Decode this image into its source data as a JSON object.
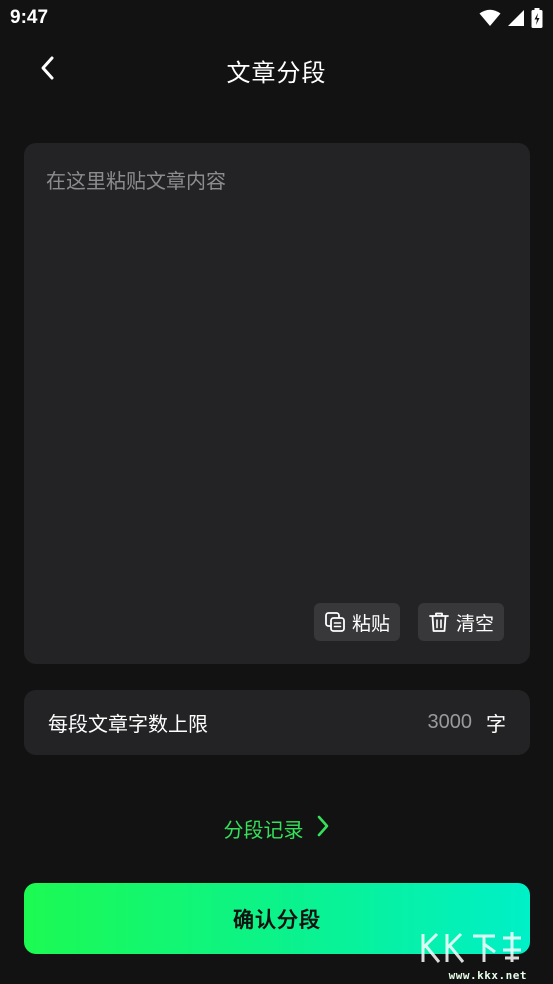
{
  "status_bar": {
    "time": "9:47",
    "icons": [
      "wifi-icon",
      "signal-icon",
      "battery-icon"
    ]
  },
  "header": {
    "title": "文章分段",
    "back_icon": "chevron-left-icon"
  },
  "article_input": {
    "placeholder": "在这里粘贴文章内容",
    "value": ""
  },
  "actions": {
    "paste_label": "粘贴",
    "paste_icon": "paste-icon",
    "clear_label": "清空",
    "clear_icon": "trash-icon"
  },
  "limit": {
    "label": "每段文章字数上限",
    "value": "3000",
    "unit": "字"
  },
  "record": {
    "label": "分段记录",
    "icon": "chevron-right-icon"
  },
  "confirm": {
    "label": "确认分段"
  },
  "watermark": {
    "url": "www.kkx.net"
  },
  "colors": {
    "background": "#121212",
    "card": "#232325",
    "accent_green": "#35e05a",
    "button_gradient_start": "#1cfa52",
    "button_gradient_end": "#00f0c8"
  }
}
